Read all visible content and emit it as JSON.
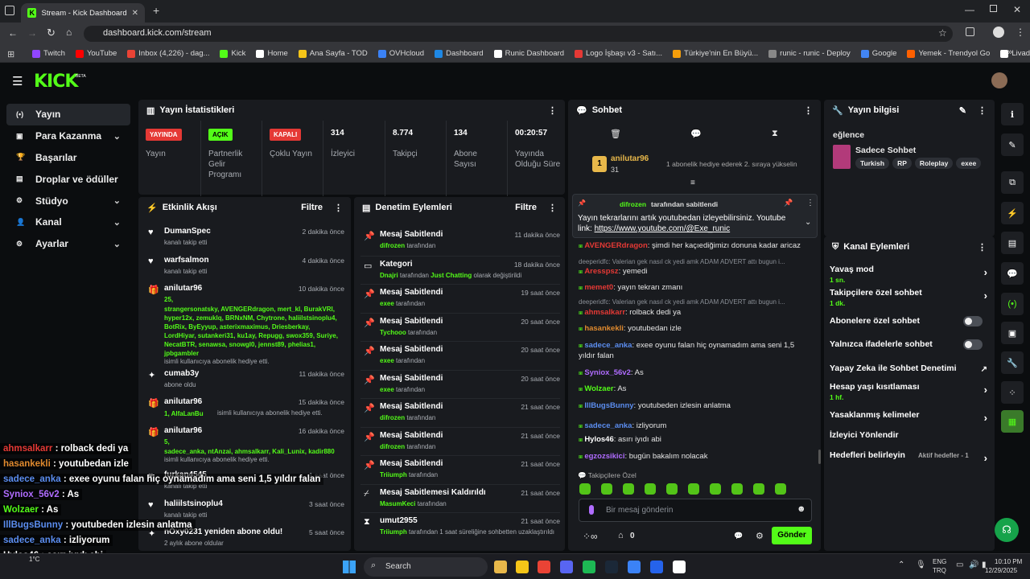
{
  "browser": {
    "tab_title": "Stream - Kick Dashboard",
    "url": "dashboard.kick.com/stream",
    "bookmarks": [
      "Twitch",
      "YouTube",
      "Inbox (4,226) - dag...",
      "Kick",
      "Home",
      "Ana Sayfa - TOD",
      "OVHcloud",
      "Dashboard",
      "Runic Dashboard",
      "Logo İşbaşı v3 - Satı...",
      "Türkiye'nin En Büyü...",
      "runic - runic - Deploy",
      "Google",
      "Yemek - Trendyol Go",
      "Livad For Streamers"
    ],
    "bookmark_colors": [
      "#9146ff",
      "#ff0000",
      "#ea4335",
      "#53fc18",
      "#ffffff",
      "#f5c518",
      "#3b82f6",
      "#1e88e5",
      "#ffffff",
      "#e53935",
      "#f59e0b",
      "#888888",
      "#4285f4",
      "#ff6000",
      "#ffffff"
    ]
  },
  "header": {
    "logo": "KICK",
    "beta": "BETA"
  },
  "sidebar": {
    "items": [
      {
        "label": "Yayın",
        "icon": "broadcast-icon"
      },
      {
        "label": "Para Kazanma",
        "icon": "wallet-icon",
        "chev": "⌄"
      },
      {
        "label": "Başarılar",
        "icon": "trophy-icon"
      },
      {
        "label": "Droplar ve ödüller",
        "icon": "gift-icon"
      },
      {
        "label": "Stüdyo",
        "icon": "gear-icon",
        "chev": "⌄"
      },
      {
        "label": "Kanal",
        "icon": "user-icon",
        "chev": "⌄"
      },
      {
        "label": "Ayarlar",
        "icon": "gear-icon",
        "chev": "⌄"
      }
    ]
  },
  "stats": {
    "title": "Yayın İstatistikleri",
    "tiles": [
      {
        "tag": "YAYINDA",
        "tag_color": "#e53935",
        "label": "Yayın"
      },
      {
        "tag": "AÇIK",
        "tag_color": "#53fc18",
        "label": "Partnerlik Gelir Programı"
      },
      {
        "tag": "KAPALI",
        "tag_color": "#e53935",
        "label": "Çoklu Yayın"
      },
      {
        "value": "314",
        "label": "İzleyici"
      },
      {
        "value": "8.774",
        "label": "Takipçi"
      },
      {
        "value": "134",
        "label": "Abone Sayısı"
      },
      {
        "value": "00:20:57",
        "label": "Yayında Olduğu Süre"
      }
    ]
  },
  "activity": {
    "title": "Etkinlik Akışı",
    "filter": "Filtre",
    "items": [
      {
        "name": "DumanSpec",
        "sub": "kanalı takip etti",
        "time": "2 dakika önce"
      },
      {
        "name": "warfsalmon",
        "sub": "kanalı takip etti",
        "time": "4 dakika önce"
      },
      {
        "name": "anilutar96",
        "count": "25,",
        "names": "strangersonatsky, AVENGERdragon, mert_kl, BurakVRI, hyper12x, zemuklq, BRNxNM, Chytrone, haliilstsinoplu4, BotRix, ByEyyup, asterixmaximus, Driesberkay, LordHiyar, sutankeri31, ku1ay, Repugg, swox359, Suriye, NecatBTR, senawsa, snowgl0, jennst89, phelias1, jpbgambler",
        "sub": "isimli kullanıcıya abonelik hediye etti.",
        "time": "10 dakika önce"
      },
      {
        "name": "cumab3y",
        "sub": "abone oldu",
        "time": "11 dakika önce"
      },
      {
        "name": "anilutar96",
        "names": "1, AlfaLanBu",
        "sub": "isimli kullanıcıya abonelik hediye etti.",
        "time": "15 dakika önce"
      },
      {
        "name": "anilutar96",
        "count": "5,",
        "names": "sadece_anka, ntAnzai, ahmsalkarr, Kali_Lunix, kadir880",
        "sub": "isimli kullanıcıya abonelik hediye etti.",
        "time": "16 dakika önce"
      },
      {
        "name": "furkan4545",
        "sub": "kanalı takip etti",
        "time": "1 saat önce"
      },
      {
        "name": "haliilstsinoplu4",
        "sub": "kanalı takip etti",
        "time": "3 saat önce"
      },
      {
        "name": "nOxy0231 yeniden abone oldu!",
        "sub": "2 aylık abone oldular",
        "time": "5 saat önce"
      }
    ]
  },
  "moderation": {
    "title": "Denetim Eylemleri",
    "filter": "Filtre",
    "items": [
      {
        "title": "Mesaj Sabitlendi",
        "user": "difrozen",
        "sub": "tarafından",
        "time": "11 dakika önce"
      },
      {
        "title": "Kategori",
        "user": "Dnajri",
        "sub": "tarafından",
        "extra": "Just Chatting",
        "extra2": "olarak değiştirildi",
        "time": "18 dakika önce"
      },
      {
        "title": "Mesaj Sabitlendi",
        "user": "exee",
        "sub": "tarafından",
        "time": "19 saat önce"
      },
      {
        "title": "Mesaj Sabitlendi",
        "user": "Tychooo",
        "sub": "tarafından",
        "time": "20 saat önce"
      },
      {
        "title": "Mesaj Sabitlendi",
        "user": "exee",
        "sub": "tarafından",
        "time": "20 saat önce"
      },
      {
        "title": "Mesaj Sabitlendi",
        "user": "exee",
        "sub": "tarafından",
        "time": "20 saat önce"
      },
      {
        "title": "Mesaj Sabitlendi",
        "user": "difrozen",
        "sub": "tarafından",
        "time": "21 saat önce"
      },
      {
        "title": "Mesaj Sabitlendi",
        "user": "difrozen",
        "sub": "tarafından",
        "time": "21 saat önce"
      },
      {
        "title": "Mesaj Sabitlendi",
        "user": "Triiumph",
        "sub": "tarafından",
        "time": "21 saat önce"
      },
      {
        "title": "Mesaj Sabitlemesi Kaldırıldı",
        "user": "MasumKeci",
        "sub": "tarafından",
        "time": "21 saat önce"
      },
      {
        "title": "umut2955",
        "user": "Triiumph",
        "sub": "tarafından 1 saat süreliğine sohbetten uzaklaştırıldı",
        "time": "21 saat önce"
      }
    ]
  },
  "chat": {
    "title": "Sohbet",
    "gift_user": "anilutar96",
    "gift_count": "31",
    "gift_text": "1 abonelik hediye ederek 2. sıraya yükselin",
    "pinned_by": "difrozen",
    "pinned_by_suffix": "tarafından sabitlendi",
    "pinned_text": "Yayın tekrarlarını artık youtubedan izleyebilirsiniz. Youtube link:",
    "pinned_link": "https://www.youtube.com/@Exe_runic",
    "messages": [
      {
        "user": "AVENGERdragon",
        "color": "#e53935",
        "text": ": şimdi her kaçıediğimizı donuna kadar aricaz"
      },
      {
        "reply": "deeperidfc: Valerian gek nasıl ck yedi amk ADAM ADVERT attı bugun i..."
      },
      {
        "user": "Aresspsz",
        "color": "#e53935",
        "text": ": yemedi"
      },
      {
        "user": "memet0",
        "color": "#e53935",
        "text": ": yayın tekrarı zmanı"
      },
      {
        "reply": "deeperidfc: Valerian gek nasıl ck yedi amk ADAM ADVERT attı bugun i..."
      },
      {
        "user": "ahmsalkarr",
        "color": "#e53935",
        "text": ": rolback dedi ya"
      },
      {
        "user": "hasankekli",
        "color": "#e08a2e",
        "text": ": youtubedan izle"
      },
      {
        "user": "sadece_anka",
        "color": "#5b8def",
        "text": ": exee oyunu falan hiç oynamadım ama seni 1,5 yıldır falan"
      },
      {
        "user": "Syniox_56v2",
        "color": "#b06cff",
        "text": ": As"
      },
      {
        "user": "Wolzaer",
        "color": "#53fc18",
        "text": ": As"
      },
      {
        "user": "IllBugsBunny",
        "color": "#5b8def",
        "text": ": youtubeden izlesin anlatma"
      },
      {
        "user": "sadece_anka",
        "color": "#5b8def",
        "text": ": izliyorum"
      },
      {
        "user": "Hylos46",
        "color": "#ffffff",
        "text": ": asırı iyıdı abi"
      },
      {
        "user": "egzozsikici",
        "color": "#b06cff",
        "text": ": bugün bakalım nolacak"
      }
    ],
    "followers_only": "Takipçilere Özel",
    "input_placeholder": "Bir mesaj gönderin",
    "points": "0",
    "send": "Gönder"
  },
  "info": {
    "title": "Yayın bilgisi",
    "stream_title": "eğlence",
    "category": "Sadece Sohbet",
    "tags": [
      "Turkish",
      "RP",
      "Roleplay",
      "exee"
    ]
  },
  "channel_actions": {
    "title": "Kanal Eylemleri",
    "items": [
      {
        "label": "Yavaş mod",
        "sub": "1 sn."
      },
      {
        "label": "Takipçilere özel sohbet",
        "sub": "1 dk."
      },
      {
        "label": "Abonelere özel sohbet"
      },
      {
        "label": "Yalnızca ifadelerle sohbet"
      },
      {
        "label": "Yapay Zeka ile Sohbet Denetimi"
      },
      {
        "label": "Hesap yaşı kısıtlaması",
        "sub": "1 hf."
      },
      {
        "label": "Yasaklanmış kelimeler"
      },
      {
        "label": "İzleyici Yönlendir"
      },
      {
        "label": "Hedefleri belirleyin",
        "sub": "Aktif hedefler - 1"
      }
    ]
  },
  "overlay": [
    {
      "user": "ahmsalkarr",
      "color": "#e53935",
      "text": " : rolback dedi ya"
    },
    {
      "user": "hasankekli",
      "color": "#e08a2e",
      "text": " : youtubedan izle"
    },
    {
      "user": "sadece_anka",
      "color": "#5b8def",
      "text": " : exee oyunu falan hiç oynamadım ama seni 1,5 yıldır falan"
    },
    {
      "user": "Syniox_56v2",
      "color": "#b06cff",
      "text": " : As"
    },
    {
      "user": "Wolzaer",
      "color": "#53fc18",
      "text": " : As"
    },
    {
      "user": "IllBugsBunny",
      "color": "#5b8def",
      "text": " : youtubeden izlesin anlatma"
    },
    {
      "user": "sadece_anka",
      "color": "#5b8def",
      "text": " : izliyorum"
    },
    {
      "user": "Hylos46",
      "color": "#ffffff",
      "text": " : asırı iyıdı abi"
    },
    {
      "user": "egzozsikici",
      "color": "#b06cff",
      "text": " : bugün bakalım nolacak"
    }
  ],
  "taskbar": {
    "search": "Search",
    "lang1": "ENG",
    "lang2": "TRQ",
    "time": "10:10 PM",
    "date": "12/29/2025",
    "temp": "1°C"
  }
}
